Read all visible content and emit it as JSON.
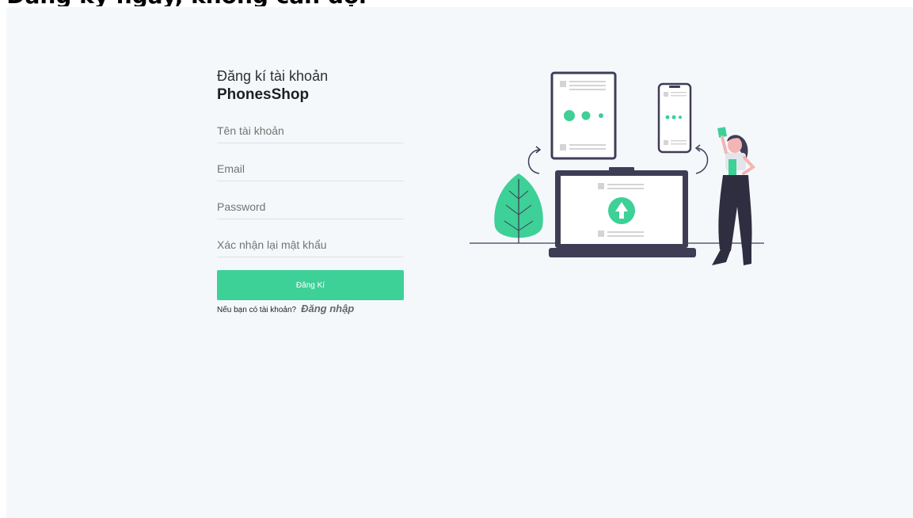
{
  "heading": "Đăng ký ngay, không cần đợi",
  "form": {
    "title_line1": "Đăng kí tài khoản",
    "title_line2": "PhonesShop",
    "fields": {
      "username_placeholder": "Tên tài khoản",
      "email_placeholder": "Email",
      "password_placeholder": "Password",
      "confirm_placeholder": "Xác nhận lại mật khẩu"
    },
    "submit_label": "Đăng Kí",
    "login_prompt": "Nếu bạn có tài khoản?",
    "login_link": "Đăng nhập"
  },
  "colors": {
    "accent": "#3dd097",
    "dark": "#3f3d56",
    "panel_bg": "#f5f8fb"
  },
  "illustration": {
    "name": "devices-illustration"
  }
}
